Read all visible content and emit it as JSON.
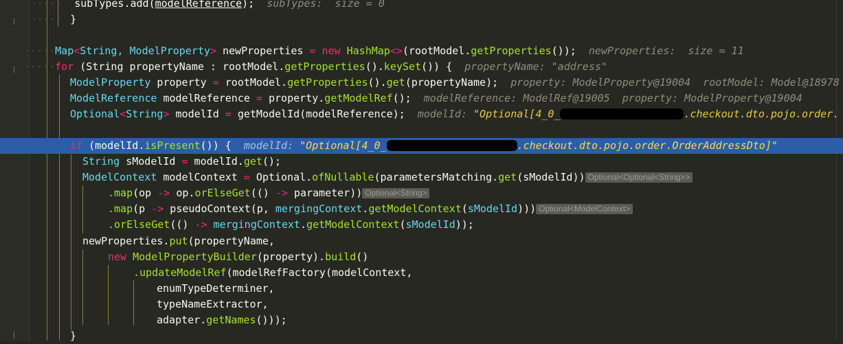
{
  "editor": {
    "lines": [
      {
        "id": "subtypes-add",
        "text_before": "subTypes.add(",
        "arg": "modelReference",
        "text_after": ");",
        "hint": "subTypes:  size = 0"
      },
      {
        "id": "close-brace-1",
        "text": "}"
      },
      {
        "id": "blank-1",
        "text": ""
      },
      {
        "id": "map-decl",
        "t1": "Map",
        "t2": "<String, ModelProperty>",
        "t3": " newProperties ",
        "t4": "=",
        "t5": " new ",
        "t6": "HashMap<>",
        "t7": "(rootModel.",
        "t8": "getProperties",
        "t9": "());",
        "hint": "newProperties:  size = 11"
      },
      {
        "id": "for-loop",
        "kw": "for",
        "t1": " (String propertyName : rootModel.",
        "t2": "getProperties",
        "t3": "().",
        "t4": "keySet",
        "t5": "()) {",
        "hint_label": "propertyName:",
        "hint_value": "\"address\""
      },
      {
        "id": "model-property",
        "t1": "ModelProperty",
        "t2": " property ",
        "t3": "=",
        "t4": " rootModel.",
        "t5": "getProperties",
        "t6": "().",
        "t7": "get",
        "t8": "(propertyName);",
        "hint": "property: ModelProperty@19004  rootModel: Model@18978"
      },
      {
        "id": "model-reference",
        "t1": "ModelReference",
        "t2": " modelReference ",
        "t3": "=",
        "t4": " property.",
        "t5": "getModelRef",
        "t6": "();",
        "hint": "modelReference: ModelRef@19005  property: ModelProperty@19004"
      },
      {
        "id": "optional-decl",
        "t1": "Optional",
        "t2": "<String>",
        "t3": " modelId ",
        "t4": "=",
        "t5": " getModelId(modelReference);",
        "hint_label": "modelId:",
        "hint_value_a": "\"Optional[4_0_",
        "hint_value_b": ".checkout.dto.pojo.order."
      },
      {
        "id": "blank-2",
        "text": ""
      },
      {
        "id": "if-present",
        "kw": "if",
        "t1": " (modelId.",
        "t2": "isPresent",
        "t3": "()) {",
        "hint_label": "modelId:",
        "hint_value_a": "\"Optional[4_0_",
        "hint_value_b": ".checkout.dto.pojo.order.OrderAddressDto]\""
      },
      {
        "id": "smodelid",
        "t1": "String",
        "t2": " sModelId ",
        "t3": "=",
        "t4": " modelId.",
        "t5": "get",
        "t6": "();"
      },
      {
        "id": "model-context",
        "t1": "ModelContext",
        "t2": " modelContext ",
        "t3": "=",
        "t4": " Optional.",
        "t5": "ofNullable",
        "t6": "(parametersMatching.",
        "t7": "get",
        "t8": "(sModelId))",
        "badge": "Optional<Optional<String>>"
      },
      {
        "id": "map-op",
        "t1": ".map",
        "t2": "(op ",
        "t3": "->",
        "t4": " op.",
        "t5": "orElseGet",
        "t6": "(() ",
        "t7": "->",
        "t8": " parameter))",
        "badge": "Optional<String>"
      },
      {
        "id": "map-p",
        "t1": ".map",
        "t2": "(p ",
        "t3": "->",
        "t4": " pseudoContext(p, ",
        "t5": "mergingContext",
        "t6": ".",
        "t7": "getModelContext",
        "t8": "(",
        "t9": "sModelId",
        "t10": ")))",
        "badge": "Optional<ModelContext>"
      },
      {
        "id": "or-else-get",
        "t1": ".orElseGet",
        "t2": "(() ",
        "t3": "->",
        "t4": " ",
        "t5": "mergingContext",
        "t6": ".",
        "t7": "getModelContext",
        "t8": "(",
        "t9": "sModelId",
        "t10": "));"
      },
      {
        "id": "new-properties-put",
        "t1": "newProperties.",
        "t2": "put",
        "t3": "(propertyName,"
      },
      {
        "id": "new-builder",
        "t1": "new",
        "t2": " ModelPropertyBuilder",
        "t3": "(property).",
        "t4": "build",
        "t5": "()"
      },
      {
        "id": "update-model-ref",
        "t1": ".updateModelRef",
        "t2": "(modelRefFactory(modelContext,"
      },
      {
        "id": "enum-type",
        "t1": "enumTypeDeterminer,"
      },
      {
        "id": "type-name",
        "t1": "typeNameExtractor,"
      },
      {
        "id": "adapter",
        "t1": "adapter.",
        "t2": "getNames",
        "t3": "()));"
      },
      {
        "id": "close-brace-2",
        "text": "}"
      }
    ]
  },
  "colors": {
    "background": "#272822",
    "highlight": "#2b5ea6",
    "keyword": "#f92672",
    "type": "#66d9ef",
    "method": "#a6e22e"
  }
}
